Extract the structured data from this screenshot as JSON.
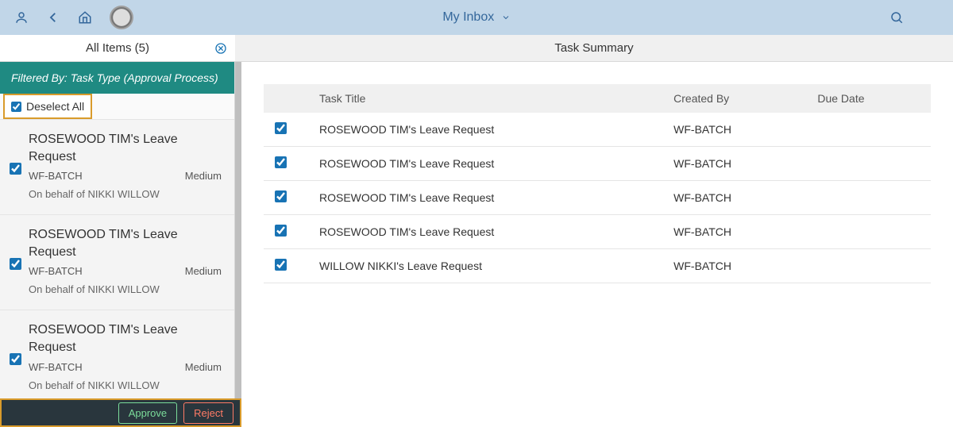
{
  "shell": {
    "title": "My Inbox"
  },
  "subheader": {
    "left_title": "All Items (5)",
    "right_title": "Task Summary"
  },
  "master": {
    "filter_text": "Filtered By: Task Type (Approval Process)",
    "deselect_label": "Deselect All",
    "items": [
      {
        "title": "ROSEWOOD TIM's Leave Request",
        "createdBy": "WF-BATCH",
        "priority": "Medium",
        "behalf": "On behalf of NIKKI WILLOW",
        "checked": true
      },
      {
        "title": "ROSEWOOD TIM's Leave Request",
        "createdBy": "WF-BATCH",
        "priority": "Medium",
        "behalf": "On behalf of NIKKI WILLOW",
        "checked": true
      },
      {
        "title": "ROSEWOOD TIM's Leave Request",
        "createdBy": "WF-BATCH",
        "priority": "Medium",
        "behalf": "On behalf of NIKKI WILLOW",
        "checked": true
      }
    ]
  },
  "table": {
    "columns": {
      "title": "Task Title",
      "createdBy": "Created By",
      "dueDate": "Due Date"
    },
    "rows": [
      {
        "title": "ROSEWOOD TIM's Leave Request",
        "createdBy": "WF-BATCH",
        "dueDate": "",
        "checked": true
      },
      {
        "title": "ROSEWOOD TIM's Leave Request",
        "createdBy": "WF-BATCH",
        "dueDate": "",
        "checked": true
      },
      {
        "title": "ROSEWOOD TIM's Leave Request",
        "createdBy": "WF-BATCH",
        "dueDate": "",
        "checked": true
      },
      {
        "title": "ROSEWOOD TIM's Leave Request",
        "createdBy": "WF-BATCH",
        "dueDate": "",
        "checked": true
      },
      {
        "title": "WILLOW NIKKI's Leave Request",
        "createdBy": "WF-BATCH",
        "dueDate": "",
        "checked": true
      }
    ]
  },
  "footer": {
    "approve": "Approve",
    "reject": "Reject"
  }
}
